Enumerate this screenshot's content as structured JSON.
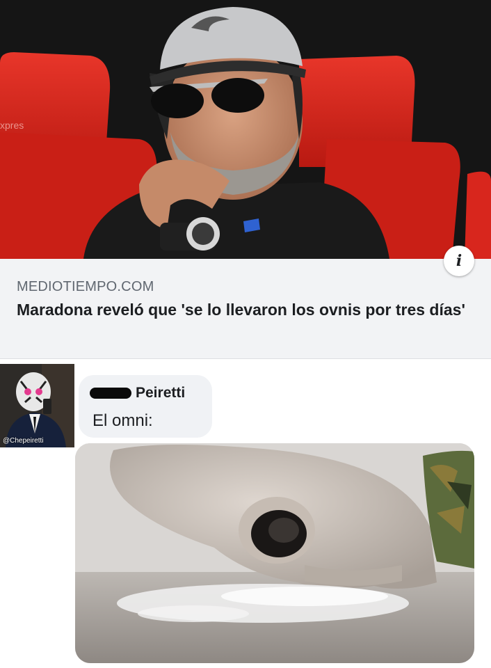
{
  "link_preview": {
    "image_alt": "Hombre con gorra y lentes oscuros sentado en butaca roja",
    "domain": "MEDIOTIEMPO.COM",
    "title": "Maradona reveló que 'se lo llevaron los ovnis por tres días'",
    "info_icon": "i"
  },
  "comment": {
    "avatar_caption": "@Chepeiretti",
    "author": "Peiretti",
    "text": "El omni:",
    "media_alt": "Alien inclinado sobre una mesa con polvo blanco"
  },
  "colors": {
    "card_background": "#f2f3f5",
    "bubble_background": "#f0f2f5",
    "seat_red": "#d8261d",
    "text_primary": "#1c1e21",
    "text_secondary": "#606770"
  }
}
